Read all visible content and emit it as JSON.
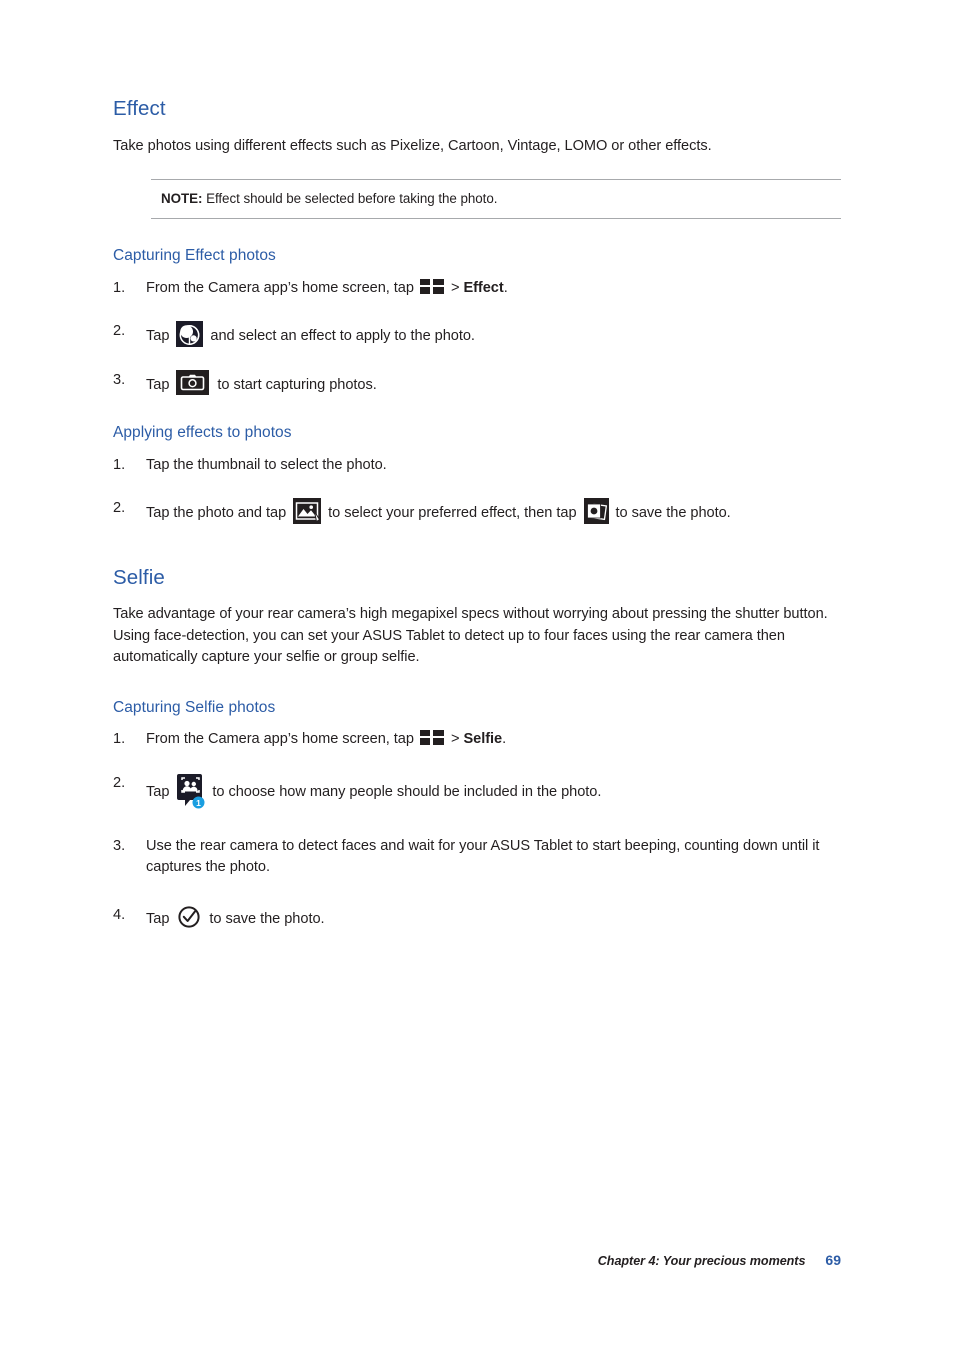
{
  "page": {
    "number": "69",
    "footer_chapter": "Chapter 4: Your precious moments"
  },
  "sections": [
    {
      "id": "effect",
      "title": "Effect",
      "intro": "Take photos using different effects such as Pixelize, Cartoon, Vintage, LOMO or other effects.",
      "note": {
        "label": "NOTE:",
        "text": "Effect should be selected before taking the photo."
      },
      "subsections": [
        {
          "id": "capturing-effect-photos",
          "title": "Capturing Effect photos",
          "steps": [
            {
              "num": "1.",
              "parts": [
                {
                  "t": "text",
                  "v": "From the Camera app’s home screen, tap "
                },
                {
                  "t": "icon",
                  "v": "grid-mode-icon"
                },
                {
                  "t": "text",
                  "v": " > "
                },
                {
                  "t": "bold",
                  "v": "Effect"
                },
                {
                  "t": "text",
                  "v": "."
                }
              ]
            },
            {
              "num": "2.",
              "parts": [
                {
                  "t": "text",
                  "v": "Tap "
                },
                {
                  "t": "icon",
                  "v": "effect-filter-icon"
                },
                {
                  "t": "text",
                  "v": " and select an effect to apply to the photo."
                }
              ]
            },
            {
              "num": "3.",
              "parts": [
                {
                  "t": "text",
                  "v": "Tap "
                },
                {
                  "t": "icon",
                  "v": "camera-shutter-icon"
                },
                {
                  "t": "text",
                  "v": " to start capturing photos."
                }
              ]
            }
          ]
        },
        {
          "id": "applying-effects-to-photos",
          "title": "Applying effects to photos",
          "steps": [
            {
              "num": "1.",
              "parts": [
                {
                  "t": "text",
                  "v": "Tap the thumbnail to select the photo."
                }
              ]
            },
            {
              "num": "2.",
              "parts": [
                {
                  "t": "text",
                  "v": "Tap the photo and tap "
                },
                {
                  "t": "icon",
                  "v": "photo-edit-wand-icon"
                },
                {
                  "t": "text",
                  "v": " to select your preferred effect, then tap "
                },
                {
                  "t": "icon",
                  "v": "save-photo-icon"
                },
                {
                  "t": "text",
                  "v": " to save the photo."
                }
              ]
            }
          ]
        }
      ]
    },
    {
      "id": "selfie",
      "title": "Selfie",
      "intro": "Take advantage of your rear camera’s high megapixel specs without worrying about pressing the shutter button. Using face-detection, you can set your ASUS Tablet to detect up to four faces using the rear camera then automatically capture your selfie or group selfie.",
      "subsections": [
        {
          "id": "capturing-selfie-photos",
          "title": "Capturing Selfie photos",
          "steps": [
            {
              "num": "1.",
              "parts": [
                {
                  "t": "text",
                  "v": "From the Camera app’s home screen, tap "
                },
                {
                  "t": "icon",
                  "v": "grid-mode-icon"
                },
                {
                  "t": "text",
                  "v": " > "
                },
                {
                  "t": "bold",
                  "v": "Selfie"
                },
                {
                  "t": "text",
                  "v": "."
                }
              ]
            },
            {
              "num": "2.",
              "parts": [
                {
                  "t": "text",
                  "v": "Tap "
                },
                {
                  "t": "icon",
                  "v": "face-count-icon"
                },
                {
                  "t": "text",
                  "v": " to choose how many people should be included in the photo."
                }
              ]
            },
            {
              "num": "3.",
              "parts": [
                {
                  "t": "text",
                  "v": "Use the rear camera to detect faces and wait for your ASUS Tablet to start beeping, counting down until it captures the photo."
                }
              ]
            },
            {
              "num": "4.",
              "parts": [
                {
                  "t": "text",
                  "v": "Tap "
                },
                {
                  "t": "icon",
                  "v": "check-circle-icon"
                },
                {
                  "t": "text",
                  "v": " to save the photo."
                }
              ]
            }
          ]
        }
      ]
    }
  ],
  "icons": {
    "face_count_badge": "1"
  },
  "colors": {
    "heading_blue": "#2c5ca6",
    "body_text": "#231f20",
    "rule": "#a7a9ac",
    "badge_blue": "#1a9ee0"
  }
}
